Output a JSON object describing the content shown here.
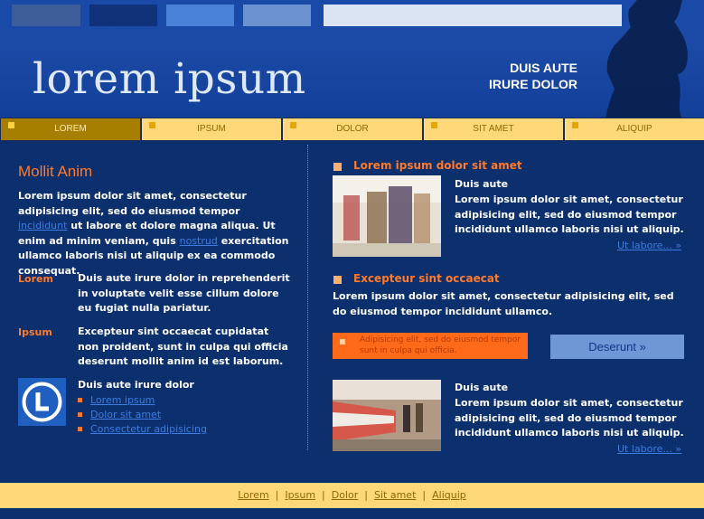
{
  "header": {
    "logo_text": "lorem ipsum",
    "tagline_line1": "DUIS AUTE",
    "tagline_line2": "IRURE DOLOR",
    "swatch_colors": [
      "#3c5d98",
      "#0f3279",
      "#4a82d8",
      "#6d92d0",
      "#dbe4f2"
    ]
  },
  "nav": {
    "items": [
      {
        "label": "LOREM",
        "active": true
      },
      {
        "label": "IPSUM",
        "active": false
      },
      {
        "label": "DOLOR",
        "active": false
      },
      {
        "label": "SIT AMET",
        "active": false
      },
      {
        "label": "ALIQUIP",
        "active": false
      }
    ]
  },
  "left": {
    "heading": "Mollit Anim",
    "intro_part1": "Lorem ipsum dolor sit amet, consectetur adipisicing elit, sed do eiusmod tempor",
    "intro_link1": "incididunt",
    "intro_part2": "ut labore et dolore magna aliqua. Ut enim ad minim veniam, quis",
    "intro_link2": "nostrud",
    "intro_part3": "exercitation ullamco laboris nisi ut aliquip ex ea commodo consequat.",
    "def1_label": "Lorem",
    "def1_text": "Duis aute irure dolor in reprehenderit in voluptate velit esse cillum dolore eu fugiat nulla pariatur.",
    "def2_label": "Ipsum",
    "def2_text": "Excepteur sint occaecat cupidatat non proident, sunt in culpa qui officia deserunt mollit anim id est laborum.",
    "box_title": "Duis aute irure dolor",
    "box_links": [
      "Lorem ipsum",
      "Dolor sit amet",
      "Consectetur adipisicing"
    ]
  },
  "right": {
    "section1_title": "Lorem ipsum dolor sit amet",
    "section1_sub": "Duis aute",
    "section1_text": "Lorem ipsum dolor sit amet, consectetur adipisicing elit, sed do eiusmod tempor incididunt ullamco laboris nisi ut aliquip.",
    "section1_more": "Ut labore... »",
    "section2_title": "Excepteur sint occaecat",
    "section2_text": "Lorem ipsum dolor sit amet, consectetur adipisicing elit, sed do eiusmod tempor incididunt ullamco.",
    "orange_box_text": "Adipisicing elit, sed do eiusmod tempor sunt in culpa qui officia.",
    "button_label": "Deserunt »",
    "section3_sub": "Duis aute",
    "section3_text": "Lorem ipsum dolor sit amet, consectetur adipisicing elit, sed do eiusmod tempor incididunt ullamco laboris nisi ut aliquip.",
    "section3_more": "Ut labore... »"
  },
  "footer": {
    "links": [
      "Lorem",
      "Ipsum",
      "Dolor",
      "Sit amet",
      "Aliquip"
    ]
  }
}
